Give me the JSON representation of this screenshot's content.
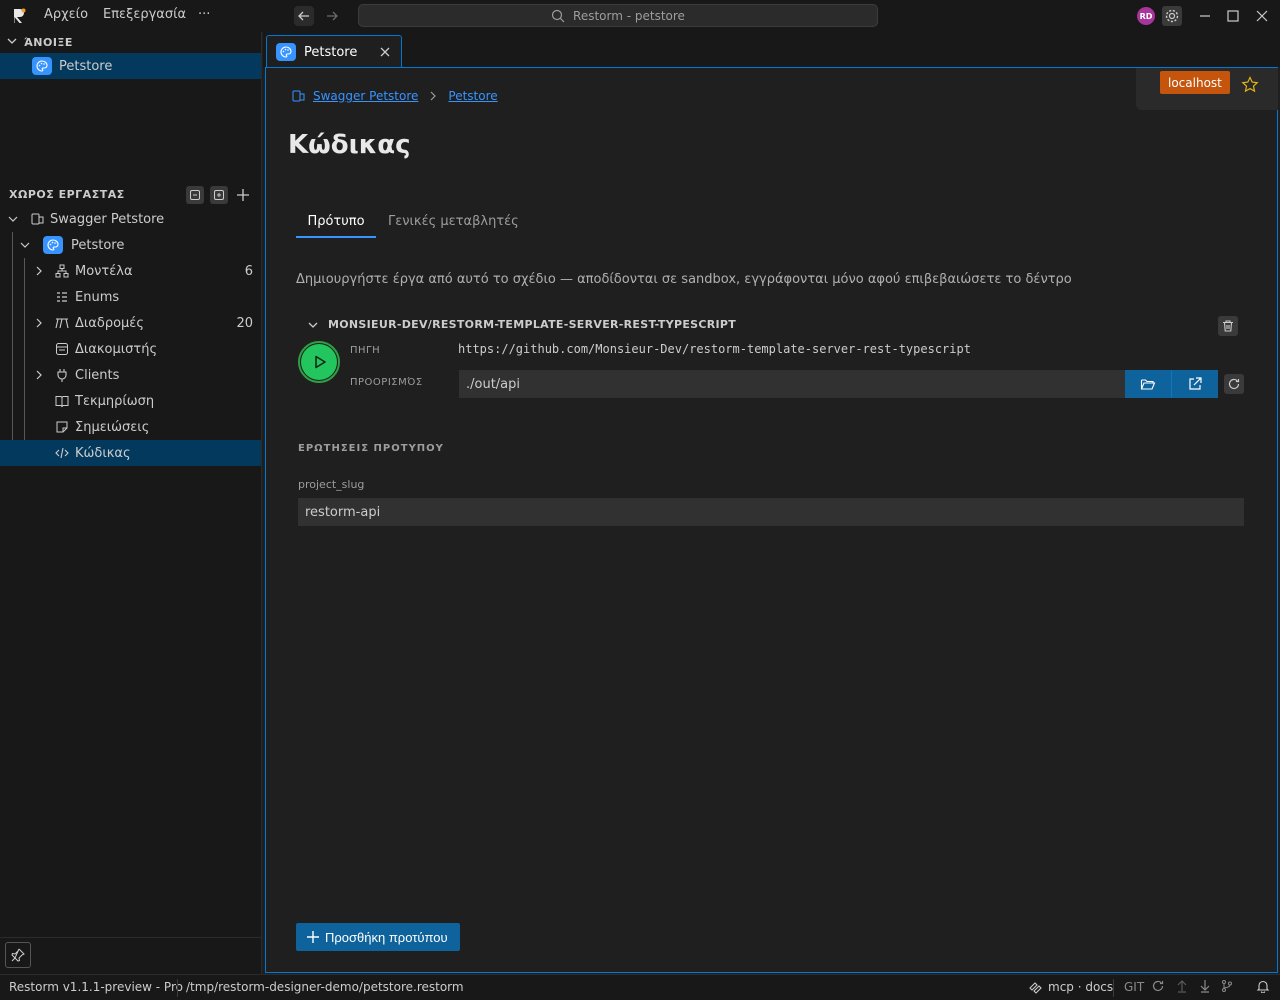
{
  "titlebar": {
    "menu": [
      "Αρχείο",
      "Επεξεργασία",
      "···"
    ],
    "search_text": "Restorm - petstore",
    "avatar_initials": "RD"
  },
  "sidebar": {
    "open_header": "ΆΝΟΙΞΕ",
    "open_item": "Petstore",
    "workspace_header": "ΧΩΡΟΣ ΕΡΓΑΣΤΑΣ",
    "tree": {
      "root": "Swagger Petstore",
      "project": "Petstore",
      "items": [
        {
          "label": "Μοντέλα",
          "count": "6",
          "icon": "models-icon",
          "expandable": true
        },
        {
          "label": "Enums",
          "count": "",
          "icon": "enums-icon",
          "expandable": false
        },
        {
          "label": "Διαδρομές",
          "count": "20",
          "icon": "routes-icon",
          "expandable": true
        },
        {
          "label": "Διακομιστής",
          "count": "",
          "icon": "server-icon",
          "expandable": false
        },
        {
          "label": "Clients",
          "count": "",
          "icon": "plug-icon",
          "expandable": true
        },
        {
          "label": "Τεκμηρίωση",
          "count": "",
          "icon": "book-icon",
          "expandable": false
        },
        {
          "label": "Σημειώσεις",
          "count": "",
          "icon": "note-icon",
          "expandable": false
        },
        {
          "label": "Κώδικας",
          "count": "",
          "icon": "code-icon",
          "expandable": false,
          "selected": true
        }
      ]
    }
  },
  "editor": {
    "tab_label": "Petstore",
    "breadcrumb": [
      "Swagger Petstore",
      "Petstore"
    ],
    "page_title": "Κώδικας",
    "env_badge": "localhost",
    "tabs": [
      "Πρότυπο",
      "Γενικές μεταβλητές"
    ],
    "description": "Δημιουργήστε έργα από αυτό το σχέδιο — αποδίδονται σε sandbox, εγγράφονται μόνο αφού επιβεβαιώσετε το δέντρο",
    "template": {
      "name": "MONSIEUR-DEV/RESTORM-TEMPLATE-SERVER-REST-TYPESCRIPT",
      "source_label": "ΠΗΓΗ",
      "source_value": "https://github.com/Monsieur-Dev/restorm-template-server-rest-typescript",
      "dest_label": "ΠΡΟΟΡΙΣΜΌΣ",
      "dest_value": "./out/api"
    },
    "questions_header": "ΕΡΩΤΗΣΕΙΣ ΠΡΟΤΥΠΟΥ",
    "question_label": "project_slug",
    "question_value": "restorm-api",
    "add_button": "Προσθήκη προτύπου"
  },
  "statusbar": {
    "version": "Restorm v1.1.1-preview - Pro",
    "path": "/tmp/restorm-designer-demo/petstore.restorm",
    "mcp": "mcp · docs",
    "git": "GIT"
  },
  "colors": {
    "accent": "#0078d4",
    "selection": "#04395e",
    "env_badge": "#c5550d",
    "run": "#22c55e",
    "button": "#0e639c"
  }
}
